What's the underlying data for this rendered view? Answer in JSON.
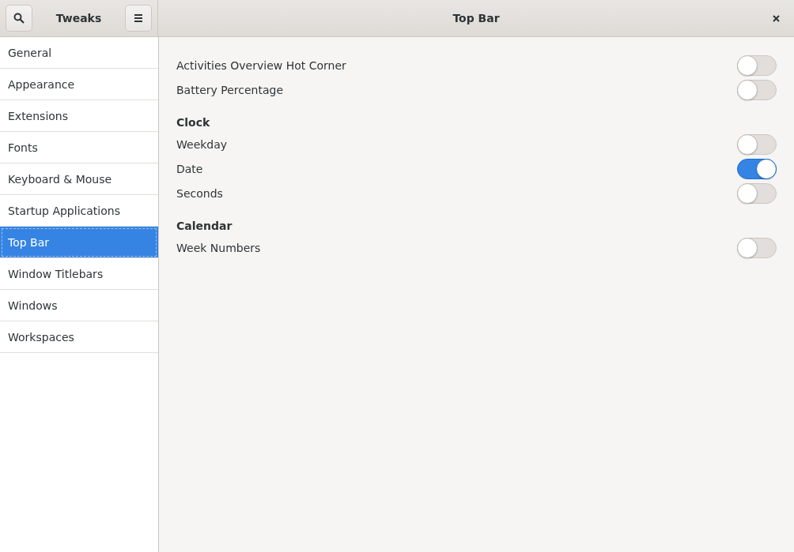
{
  "sidebar": {
    "title": "Tweaks",
    "items": [
      {
        "label": "General",
        "selected": false
      },
      {
        "label": "Appearance",
        "selected": false
      },
      {
        "label": "Extensions",
        "selected": false
      },
      {
        "label": "Fonts",
        "selected": false
      },
      {
        "label": "Keyboard & Mouse",
        "selected": false
      },
      {
        "label": "Startup Applications",
        "selected": false
      },
      {
        "label": "Top Bar",
        "selected": true
      },
      {
        "label": "Window Titlebars",
        "selected": false
      },
      {
        "label": "Windows",
        "selected": false
      },
      {
        "label": "Workspaces",
        "selected": false
      }
    ]
  },
  "window": {
    "title": "Top Bar"
  },
  "sections": [
    {
      "rows": [
        {
          "label": "Activities Overview Hot Corner",
          "on": false
        },
        {
          "label": "Battery Percentage",
          "on": false
        }
      ]
    },
    {
      "heading": "Clock",
      "rows": [
        {
          "label": "Weekday",
          "on": false
        },
        {
          "label": "Date",
          "on": true
        },
        {
          "label": "Seconds",
          "on": false
        }
      ]
    },
    {
      "heading": "Calendar",
      "rows": [
        {
          "label": "Week Numbers",
          "on": false
        }
      ]
    }
  ]
}
